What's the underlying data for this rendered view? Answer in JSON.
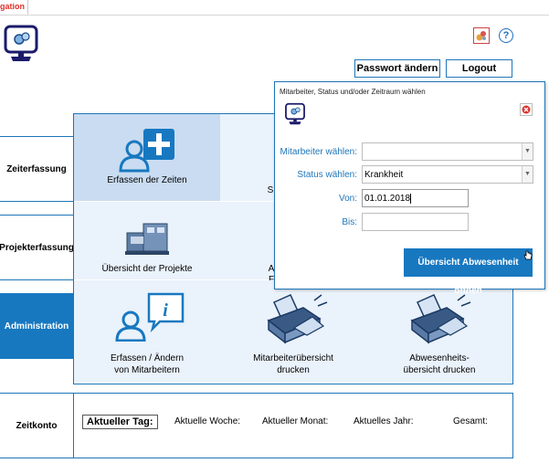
{
  "tab": {
    "label": "gation"
  },
  "header": {
    "password_button": "Passwort ändern",
    "logout_button": "Logout",
    "help_icon": "?"
  },
  "nav": {
    "items": [
      {
        "label": "Zeiterfassung"
      },
      {
        "label": "Projekterfassung"
      },
      {
        "label": "Administration",
        "active": true
      },
      {
        "label": "Zeitkonto"
      }
    ]
  },
  "tiles": {
    "erfassen_zeiten": "Erfassen der Zeiten",
    "row1_partial": "S",
    "uebersicht_projekte": "Übersicht der Projekte",
    "row2_partial_1": "A",
    "row2_partial_2": "F",
    "erfassen_mitarbeiter_line1": "Erfassen / Ändern",
    "erfassen_mitarbeiter_line2": "von Mitarbeitern",
    "mitarbeiteruebersicht_line1": "Mitarbeiterübersicht",
    "mitarbeiteruebersicht_line2": "drucken",
    "abwesenheit_line1": "Abwesenheits-",
    "abwesenheit_line2": "übersicht drucken"
  },
  "zeitkonto": {
    "today": "Aktueller Tag:",
    "week": "Aktuelle Woche:",
    "month": "Aktueller Monat:",
    "year": "Aktuelles Jahr:",
    "total": "Gesamt:"
  },
  "dialog": {
    "title": "Mitarbeiter, Status und/oder Zeitraum wählen",
    "employee_label": "Mitarbeiter wählen:",
    "employee_value": "",
    "status_label": "Status wählen:",
    "status_value": "Krankheit",
    "from_label": "Von:",
    "from_value": "01.01.2018",
    "to_label": "Bis:",
    "to_value": "",
    "open_button": "Übersicht Abwesenheit öffnen"
  },
  "colors": {
    "accent": "#1778c0",
    "tile_bg": "#eaf2fb",
    "label": "#1e75b8"
  }
}
